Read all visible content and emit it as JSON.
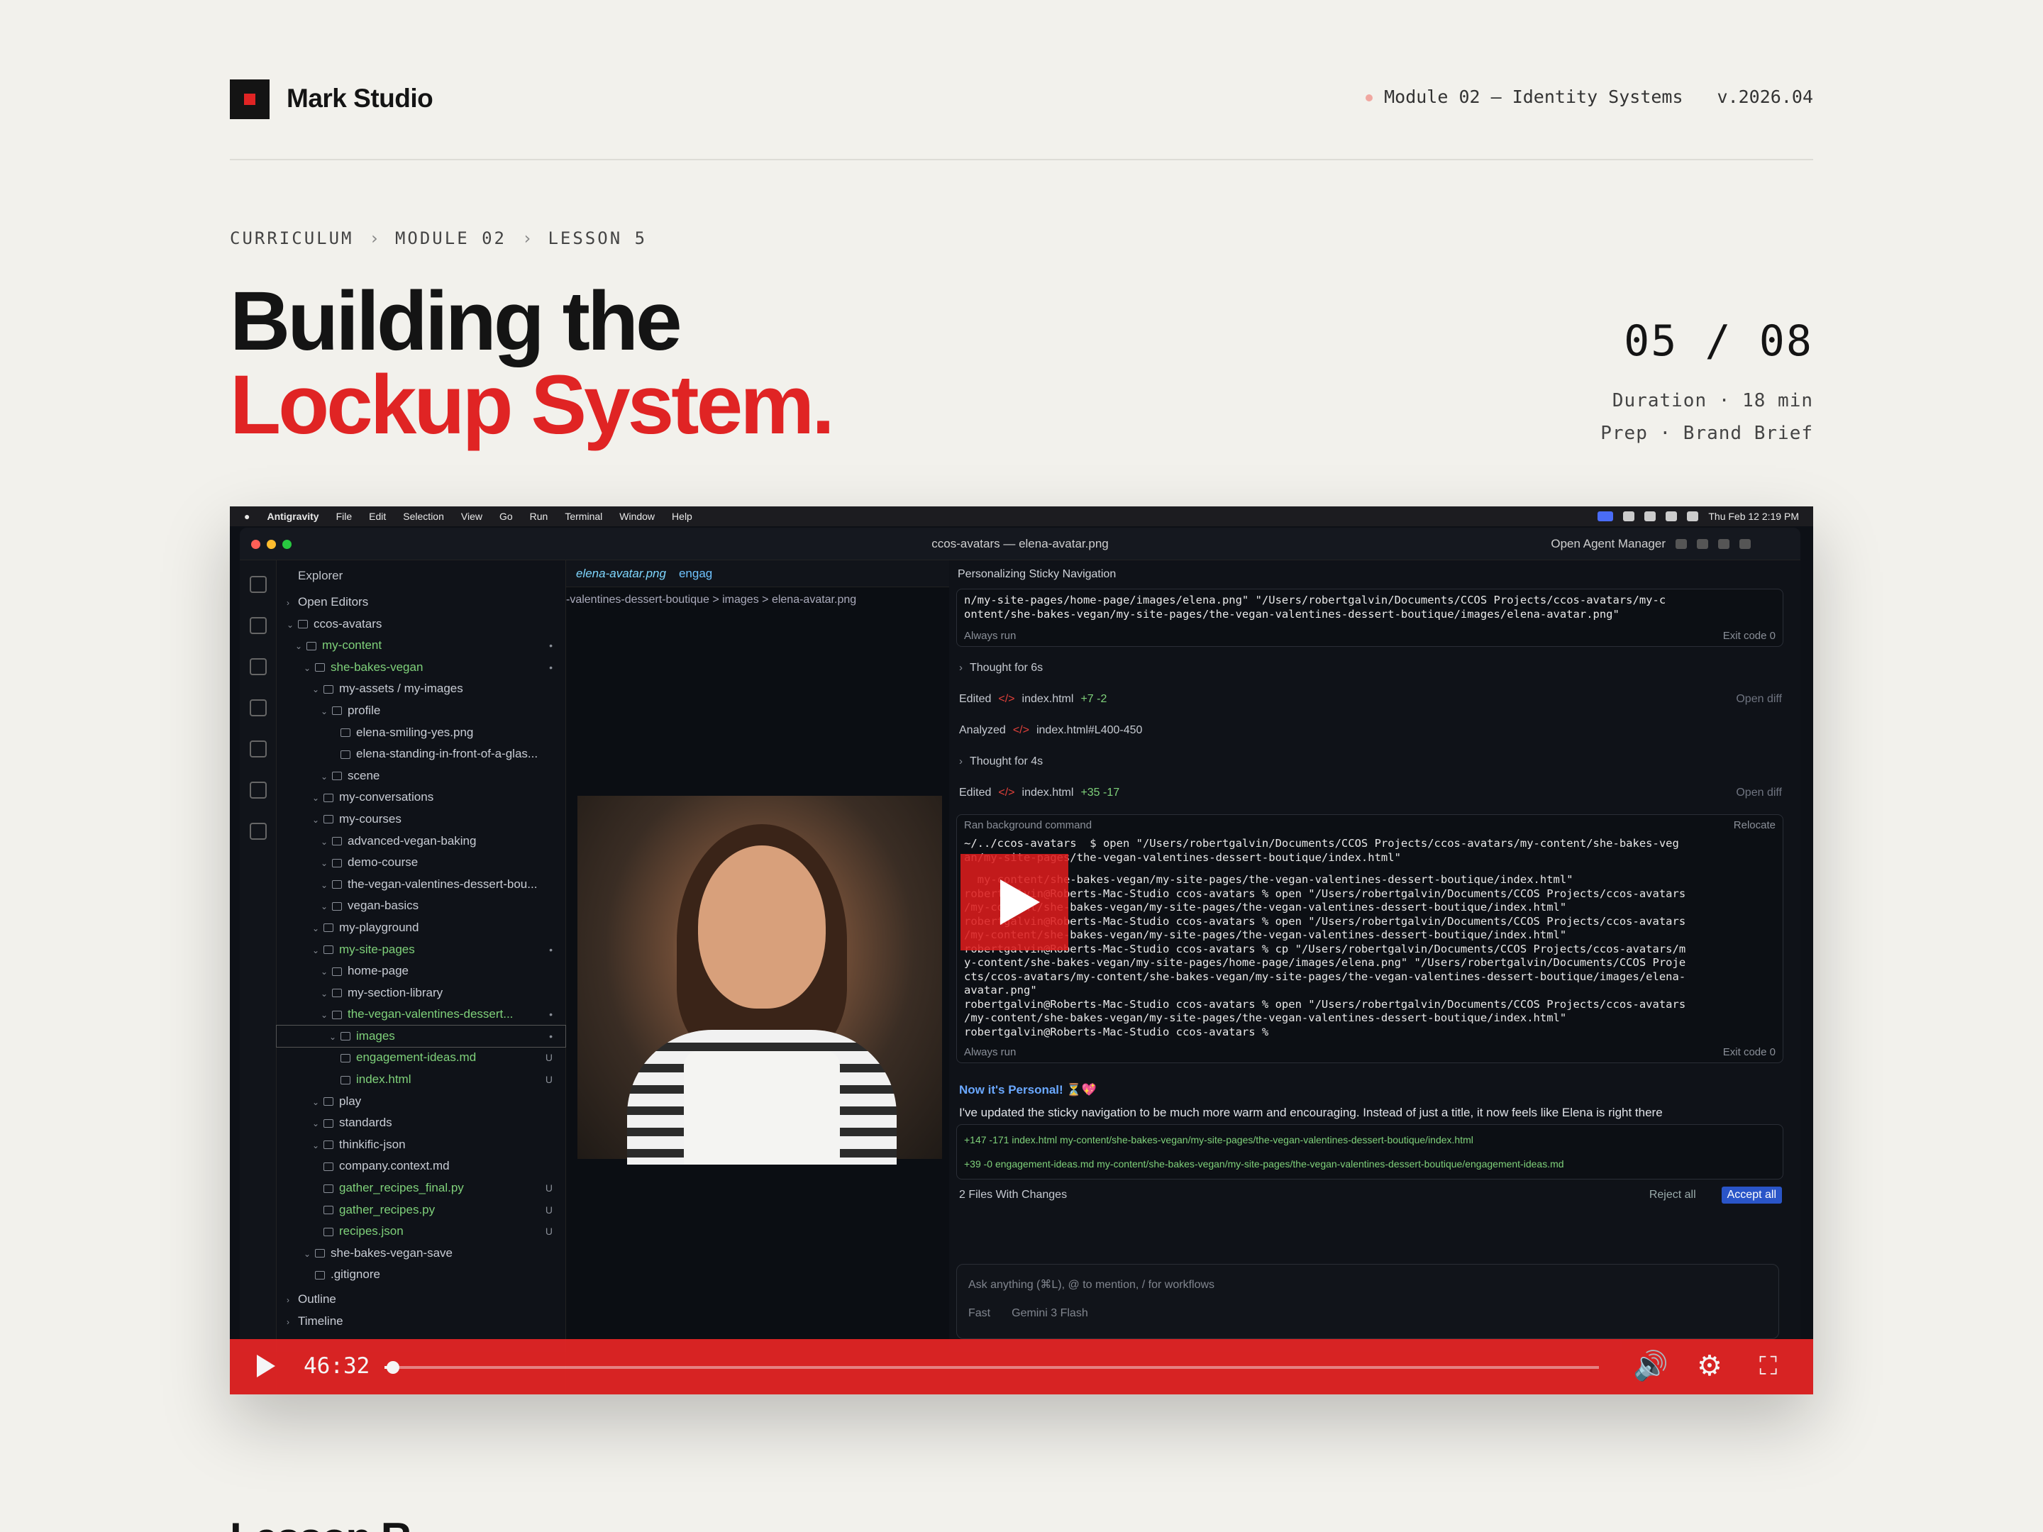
{
  "brand": {
    "name": "Mark Studio"
  },
  "header_meta": {
    "module": "Module 02 — Identity Systems",
    "version": "v.2026.04"
  },
  "breadcrumb": [
    "CURRICULUM",
    "MODULE 02",
    "LESSON 5"
  ],
  "title": {
    "line1": "Building the",
    "line2": "Lockup System."
  },
  "lesson": {
    "counter": "05 / 08",
    "duration": "Duration · 18 min",
    "prep": "Prep · Brand Brief"
  },
  "video": {
    "time": "46:32",
    "progress": 0.007,
    "mac_menu": [
      "Antigravity",
      "File",
      "Edit",
      "Selection",
      "View",
      "Go",
      "Run",
      "Terminal",
      "Window",
      "Help"
    ],
    "mac_clock": "Thu Feb 12  2:19 PM",
    "window_title": "ccos-avatars — elena-avatar.png",
    "agent_manager": "Open Agent Manager",
    "explorer": {
      "label": "Explorer",
      "open_editors": "Open Editors",
      "rows": [
        {
          "t": "ccos-avatars",
          "d": 0,
          "c": "",
          "r": ""
        },
        {
          "t": "my-content",
          "d": 1,
          "c": "green",
          "r": "•"
        },
        {
          "t": "she-bakes-vegan",
          "d": 2,
          "c": "green",
          "r": "•"
        },
        {
          "t": "my-assets / my-images",
          "d": 3,
          "c": "",
          "r": ""
        },
        {
          "t": "profile",
          "d": 4,
          "c": "",
          "r": ""
        },
        {
          "t": "elena-smiling-yes.png",
          "d": 5,
          "c": "",
          "r": ""
        },
        {
          "t": "elena-standing-in-front-of-a-glas...",
          "d": 5,
          "c": "",
          "r": ""
        },
        {
          "t": "scene",
          "d": 4,
          "c": "",
          "r": ""
        },
        {
          "t": "my-conversations",
          "d": 3,
          "c": "",
          "r": ""
        },
        {
          "t": "my-courses",
          "d": 3,
          "c": "",
          "r": ""
        },
        {
          "t": "advanced-vegan-baking",
          "d": 4,
          "c": "",
          "r": ""
        },
        {
          "t": "demo-course",
          "d": 4,
          "c": "",
          "r": ""
        },
        {
          "t": "the-vegan-valentines-dessert-bou...",
          "d": 4,
          "c": "",
          "r": ""
        },
        {
          "t": "vegan-basics",
          "d": 4,
          "c": "",
          "r": ""
        },
        {
          "t": "my-playground",
          "d": 3,
          "c": "",
          "r": ""
        },
        {
          "t": "my-site-pages",
          "d": 3,
          "c": "green",
          "r": "•"
        },
        {
          "t": "home-page",
          "d": 4,
          "c": "",
          "r": ""
        },
        {
          "t": "my-section-library",
          "d": 4,
          "c": "",
          "r": ""
        },
        {
          "t": "the-vegan-valentines-dessert...",
          "d": 4,
          "c": "green",
          "r": "•"
        },
        {
          "t": "images",
          "d": 5,
          "c": "green",
          "r": "•"
        },
        {
          "t": "engagement-ideas.md",
          "d": 5,
          "c": "green",
          "r": "U"
        },
        {
          "t": "index.html",
          "d": 5,
          "c": "green",
          "r": "U"
        },
        {
          "t": "play",
          "d": 3,
          "c": "",
          "r": ""
        },
        {
          "t": "standards",
          "d": 3,
          "c": "",
          "r": ""
        },
        {
          "t": "thinkific-json",
          "d": 3,
          "c": "",
          "r": ""
        },
        {
          "t": "company.context.md",
          "d": 3,
          "c": "",
          "r": ""
        },
        {
          "t": "gather_recipes_final.py",
          "d": 3,
          "c": "green",
          "r": "U"
        },
        {
          "t": "gather_recipes.py",
          "d": 3,
          "c": "green",
          "r": "U"
        },
        {
          "t": "recipes.json",
          "d": 3,
          "c": "green",
          "r": "U"
        },
        {
          "t": "she-bakes-vegan-save",
          "d": 2,
          "c": "",
          "r": ""
        },
        {
          "t": ".gitignore",
          "d": 2,
          "c": "",
          "r": ""
        }
      ],
      "outline": "Outline",
      "timeline": "Timeline"
    },
    "editor": {
      "tab1": "elena-avatar.png",
      "tab2": "engag",
      "breadcrumb": "-valentines-dessert-boutique > images > elena-avatar.png"
    },
    "agent": {
      "header": "Personalizing Sticky Navigation",
      "cmd_top": "n/my-site-pages/home-page/images/elena.png\" \"/Users/robertgalvin/Documents/CCOS Projects/ccos-avatars/my-c\nontent/she-bakes-vegan/my-site-pages/the-vegan-valentines-dessert-boutique/images/elena-avatar.png\"",
      "always_run": "Always run",
      "exit_code": "Exit code 0",
      "thought1": "Thought for 6s",
      "edited1": "Edited",
      "file1": "index.html",
      "diff1": "+7 -2",
      "open_diff": "Open diff",
      "analyzed": "Analyzed",
      "analyzed_file": "index.html#L400-450",
      "thought2": "Thought for 4s",
      "edited2": "Edited",
      "file2": "index.html",
      "diff2": "+35 -17",
      "bg_cmd": "Ran background command",
      "relocate": "Relocate",
      "cmd_main": "~/../ccos-avatars  $ open \"/Users/robertgalvin/Documents/CCOS Projects/ccos-avatars/my-content/she-bakes-veg\nan/my-site-pages/the-vegan-valentines-dessert-boutique/index.html\"",
      "cmd_log": "  my-content/she-bakes-vegan/my-site-pages/the-vegan-valentines-dessert-boutique/index.html\"\nrobertgalvin@Roberts-Mac-Studio ccos-avatars % open \"/Users/robertgalvin/Documents/CCOS Projects/ccos-avatars\n/my-content/she-bakes-vegan/my-site-pages/the-vegan-valentines-dessert-boutique/index.html\"\nrobertgalvin@Roberts-Mac-Studio ccos-avatars % open \"/Users/robertgalvin/Documents/CCOS Projects/ccos-avatars\n/my-content/she-bakes-vegan/my-site-pages/the-vegan-valentines-dessert-boutique/index.html\"\nrobertgalvin@Roberts-Mac-Studio ccos-avatars % cp \"/Users/robertgalvin/Documents/CCOS Projects/ccos-avatars/m\ny-content/she-bakes-vegan/my-site-pages/home-page/images/elena.png\" \"/Users/robertgalvin/Documents/CCOS Proje\ncts/ccos-avatars/my-content/she-bakes-vegan/my-site-pages/the-vegan-valentines-dessert-boutique/images/elena-\navatar.png\"\nrobertgalvin@Roberts-Mac-Studio ccos-avatars % open \"/Users/robertgalvin/Documents/CCOS Projects/ccos-avatars\n/my-content/she-bakes-vegan/my-site-pages/the-vegan-valentines-dessert-boutique/index.html\"\nrobertgalvin@Roberts-Mac-Studio ccos-avatars %",
      "personal": "Now it's Personal! ⏳💖",
      "summary": "I've updated the sticky navigation to be much more warm and encouraging. Instead of just a title, it now feels like Elena is right there",
      "change1": "+147 -171  index.html  my-content/she-bakes-vegan/my-site-pages/the-vegan-valentines-dessert-boutique/index.html",
      "change2": "+39 -0   engagement-ideas.md  my-content/she-bakes-vegan/my-site-pages/the-vegan-valentines-dessert-boutique/engagement-ideas.md",
      "files_changed": "2 Files With Changes",
      "reject_all": "Reject all",
      "accept_all": "Accept all",
      "ask_placeholder": "Ask anything (⌘L), @ to mention, / for workflows",
      "mode": "Fast",
      "model": "Gemini 3 Flash"
    }
  },
  "section_heading": "Lesson R",
  "colors": {
    "accent": "#e02424",
    "background": "#f2f1ec"
  }
}
